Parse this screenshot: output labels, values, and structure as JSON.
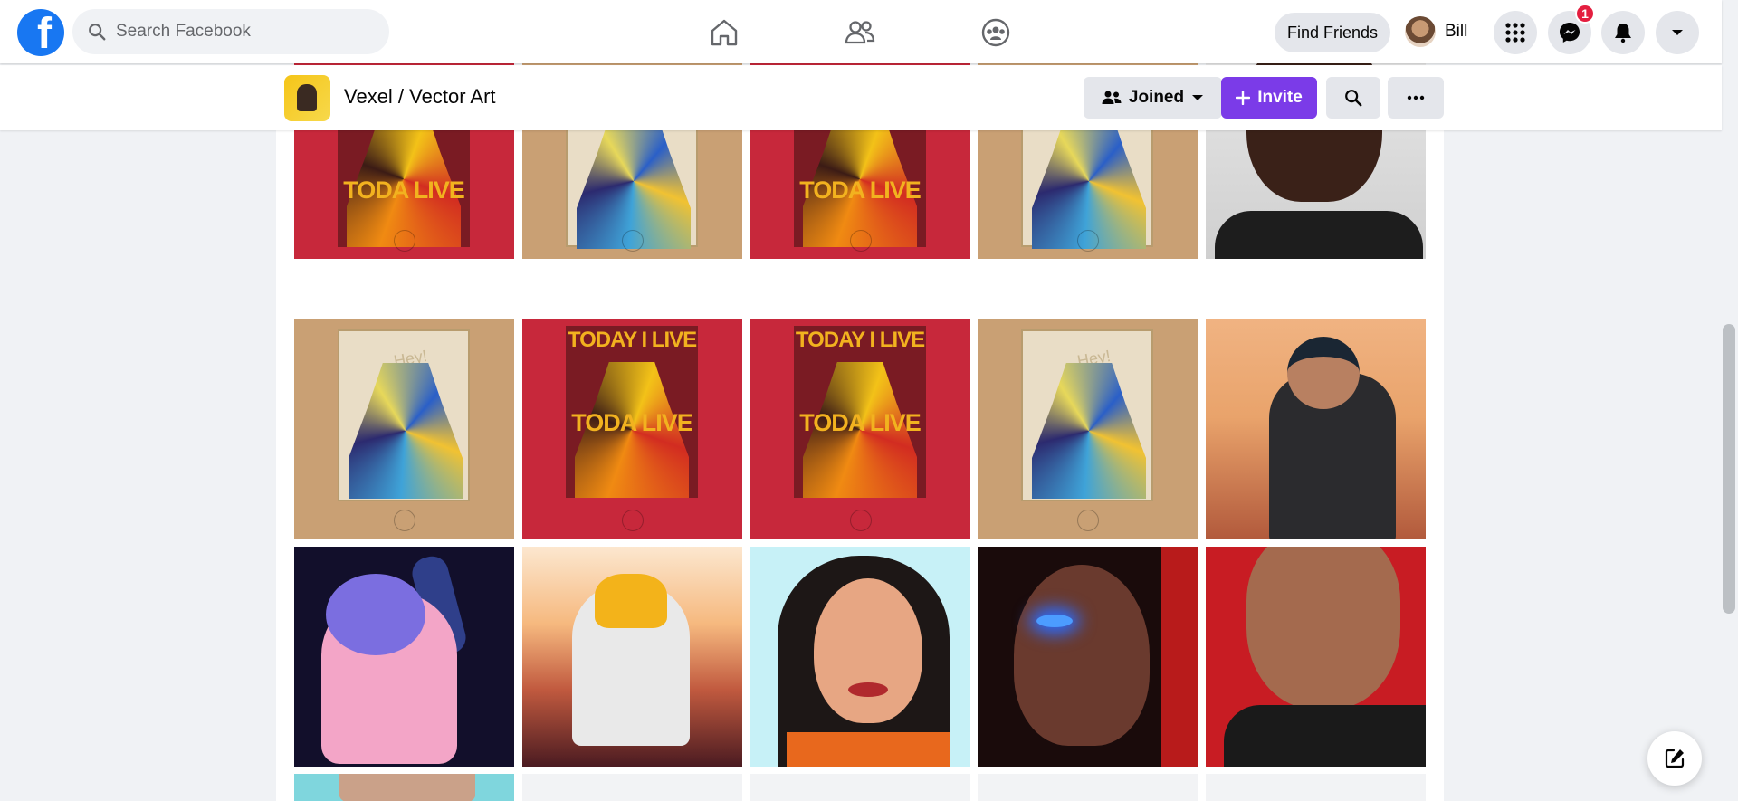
{
  "topbar": {
    "logo_letter": "f",
    "search_placeholder": "Search Facebook",
    "find_friends_label": "Find Friends",
    "profile_name": "Bill",
    "messenger_badge": "1"
  },
  "group": {
    "name": "Vexel / Vector Art",
    "joined_label": "Joined",
    "invite_label": "Invite"
  },
  "tiles": {
    "today_text": "TODAY I LIVE",
    "toda_text": "TODA",
    "live_text": "LIVE",
    "hey_text": "Hey!"
  },
  "colors": {
    "brand_blue": "#1877f2",
    "invite_purple": "#7b3be8",
    "badge_red": "#e41e3f"
  }
}
